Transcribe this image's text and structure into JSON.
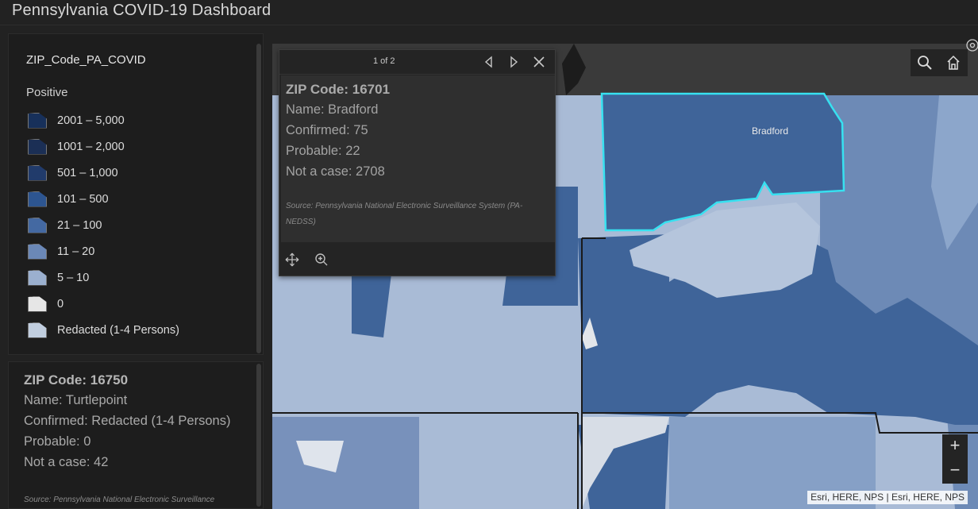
{
  "app": {
    "title": "Pennsylvania COVID-19 Dashboard"
  },
  "legend": {
    "layer_title": "ZIP_Code_PA_COVID",
    "field": "Positive",
    "items": [
      {
        "label": "2001 – 5,000",
        "color": "#17305a"
      },
      {
        "label": "1001 – 2,000",
        "color": "#1b2f55"
      },
      {
        "label": "501 – 1,000",
        "color": "#213b6b"
      },
      {
        "label": "101 – 500",
        "color": "#2d5590"
      },
      {
        "label": "21 – 100",
        "color": "#4469a2"
      },
      {
        "label": "11 – 20",
        "color": "#6b88b7"
      },
      {
        "label": "5 – 10",
        "color": "#9bb0cf"
      },
      {
        "label": "0",
        "color": "#e6e6e6"
      },
      {
        "label": "Redacted (1-4 Persons)",
        "color": "#c1cedf"
      }
    ]
  },
  "info_panel": {
    "title": "ZIP Code: 16750",
    "name": "Name: Turtlepoint",
    "confirmed": "Confirmed: Redacted (1-4 Persons)",
    "probable": "Probable: 0",
    "not_a_case": "Not a case: 42",
    "source": "Source: Pennsylvania National Electronic Surveillance"
  },
  "popup": {
    "pager": "1 of 2",
    "title": "ZIP Code: 16701",
    "name": "Name: Bradford",
    "confirmed": "Confirmed: 75",
    "probable": "Probable: 22",
    "not_a_case": "Not a case: 2708",
    "source": "Source: Pennsylvania National Electronic Surveillance System (PA-NEDSS)"
  },
  "map": {
    "place_label": "Bradford",
    "attribution": "Esri, HERE, NPS | Esri, HERE, NPS",
    "zoom_in": "+",
    "zoom_out": "−",
    "colors": {
      "dark": "#3f6499",
      "mid": "#6d8ab6",
      "light": "#a9bbd6",
      "pale": "#d4dbe6",
      "highlight": "#37e1f0"
    }
  }
}
